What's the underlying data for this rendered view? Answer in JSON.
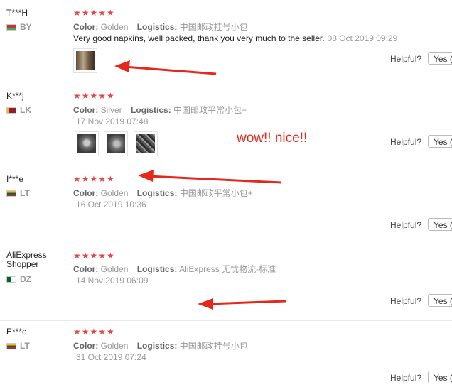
{
  "reviews": [
    {
      "user": "T***H",
      "country": "BY",
      "stars": "★★★★★",
      "color_key": "Color:",
      "color": "Golden",
      "logistics_key": "Logistics:",
      "logistics": "中国邮政挂号小包",
      "text": "Very good napkins, well packed, thank you very much to the seller.",
      "date": "08 Oct 2019 09:29",
      "helpful": "Helpful?",
      "yes": "Yes ("
    },
    {
      "user": "K***j",
      "country": "LK",
      "stars": "★★★★★",
      "color_key": "Color:",
      "color": "Silver",
      "logistics_key": "Logistics:",
      "logistics": "中国邮政平常小包+",
      "date": "17 Nov 2019 07:48",
      "helpful": "Helpful?",
      "yes": "Yes ("
    },
    {
      "user": "I***e",
      "country": "LT",
      "stars": "★★★★★",
      "color_key": "Color:",
      "color": "Golden",
      "logistics_key": "Logistics:",
      "logistics": "中国邮政平常小包+",
      "date": "16 Oct 2019 10:36",
      "helpful": "Helpful?",
      "yes": "Yes ("
    },
    {
      "user_line1": "AliExpress",
      "user_line2": "Shopper",
      "country": "DZ",
      "stars": "★★★★★",
      "color_key": "Color:",
      "color": "Golden",
      "logistics_key": "Logistics:",
      "logistics": "AliExpress 无忧物流-标准",
      "date": "14 Nov 2019 06:09",
      "helpful": "Helpful?",
      "yes": "Yes ("
    },
    {
      "user": "E***e",
      "country": "LT",
      "stars": "★★★★★",
      "color_key": "Color:",
      "color": "Golden",
      "logistics_key": "Logistics:",
      "logistics": "中国邮政挂号小包",
      "date": "31 Oct 2019 07:24",
      "helpful": "Helpful?",
      "yes": "Yes ("
    }
  ],
  "annotation": "wow!! nice!!",
  "colors": {
    "stars": "#e64545",
    "arrow": "#e5281b"
  },
  "icons": [
    "flag-icon-by",
    "flag-icon-lk",
    "flag-icon-lt",
    "flag-icon-dz",
    "photo-thumbnail",
    "red-arrow"
  ]
}
